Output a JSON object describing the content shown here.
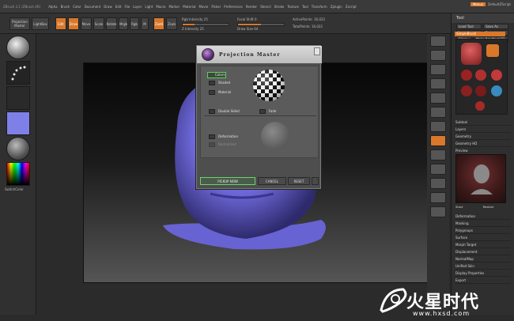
{
  "menubar": {
    "title": "ZBrush 3.1 (ZBrush 4R)",
    "items": [
      "Alpha",
      "Brush",
      "Color",
      "Document",
      "Draw",
      "Edit",
      "File",
      "Layer",
      "Light",
      "Macro",
      "Marker",
      "Material",
      "Movie",
      "Picker",
      "Preferences",
      "Render",
      "Stencil",
      "Stroke",
      "Texture",
      "Tool",
      "Transform",
      "Zplugin",
      "Zscript"
    ],
    "right_items": [
      "Menus",
      "DefaultZScript"
    ]
  },
  "toolbar": {
    "projection_master": "Projection Master",
    "lightbox": "LightBox",
    "edit": "Edit",
    "draw": "Draw",
    "move": "Move",
    "scale": "Scale",
    "rotate": "Rotate",
    "mrgb": "Mrgb",
    "rgb": "Rgb",
    "m": "M",
    "zadd": "Zadd",
    "zsub": "Zsub",
    "focal_shift": "Focal Shift 0",
    "draw_size": "Draw Size 64",
    "rgb_intensity": "Rgb Intensity 25",
    "z_intensity": "Z Intensity 25",
    "active_points": "ActivePoints: 16,022",
    "total_points": "TotalPoints: 16,022",
    "rgb_intensity_value": 0.25,
    "z_intensity_value": 0.25
  },
  "leftshelf": {
    "gradient_label": "Gradient",
    "switch_color": "SwitchColor"
  },
  "tool": {
    "title": "Tool",
    "rows": [
      "Load Tool",
      "Save As",
      "Import",
      "Export",
      "Clone",
      "Make PolyMesh3D",
      "GoZ",
      "All Visible",
      "R"
    ],
    "current": "SimpleBrush",
    "subtool_sections": [
      "Subtool",
      "Layers",
      "Geometry",
      "Geometry HD"
    ],
    "preview_label": "Preview",
    "sections": [
      "Deformation",
      "Masking",
      "Polygroups",
      "Surface",
      "Morph Target",
      "Displacement",
      "NormalMap",
      "Unified Skin",
      "Display Properties",
      "Export"
    ],
    "preview_labels": [
      "Store",
      "Restore"
    ]
  },
  "projection_master": {
    "title": "Projection Master",
    "colors": "Colors",
    "shaded": "Shaded",
    "material": "Material",
    "double_sided": "Double Sided",
    "fade": "Fade",
    "deformation": "Deformation",
    "normalized": "Normalized",
    "pickup_now": "PICKUP NOW",
    "cancel": "CANCEL",
    "reset": "RESET"
  },
  "watermark": {
    "brand": "火星时代",
    "url": "www.hxsd.com"
  },
  "colors": {
    "accent": "#d9782a",
    "highlight": "#5ccf5c",
    "head": "#6c67d6"
  }
}
